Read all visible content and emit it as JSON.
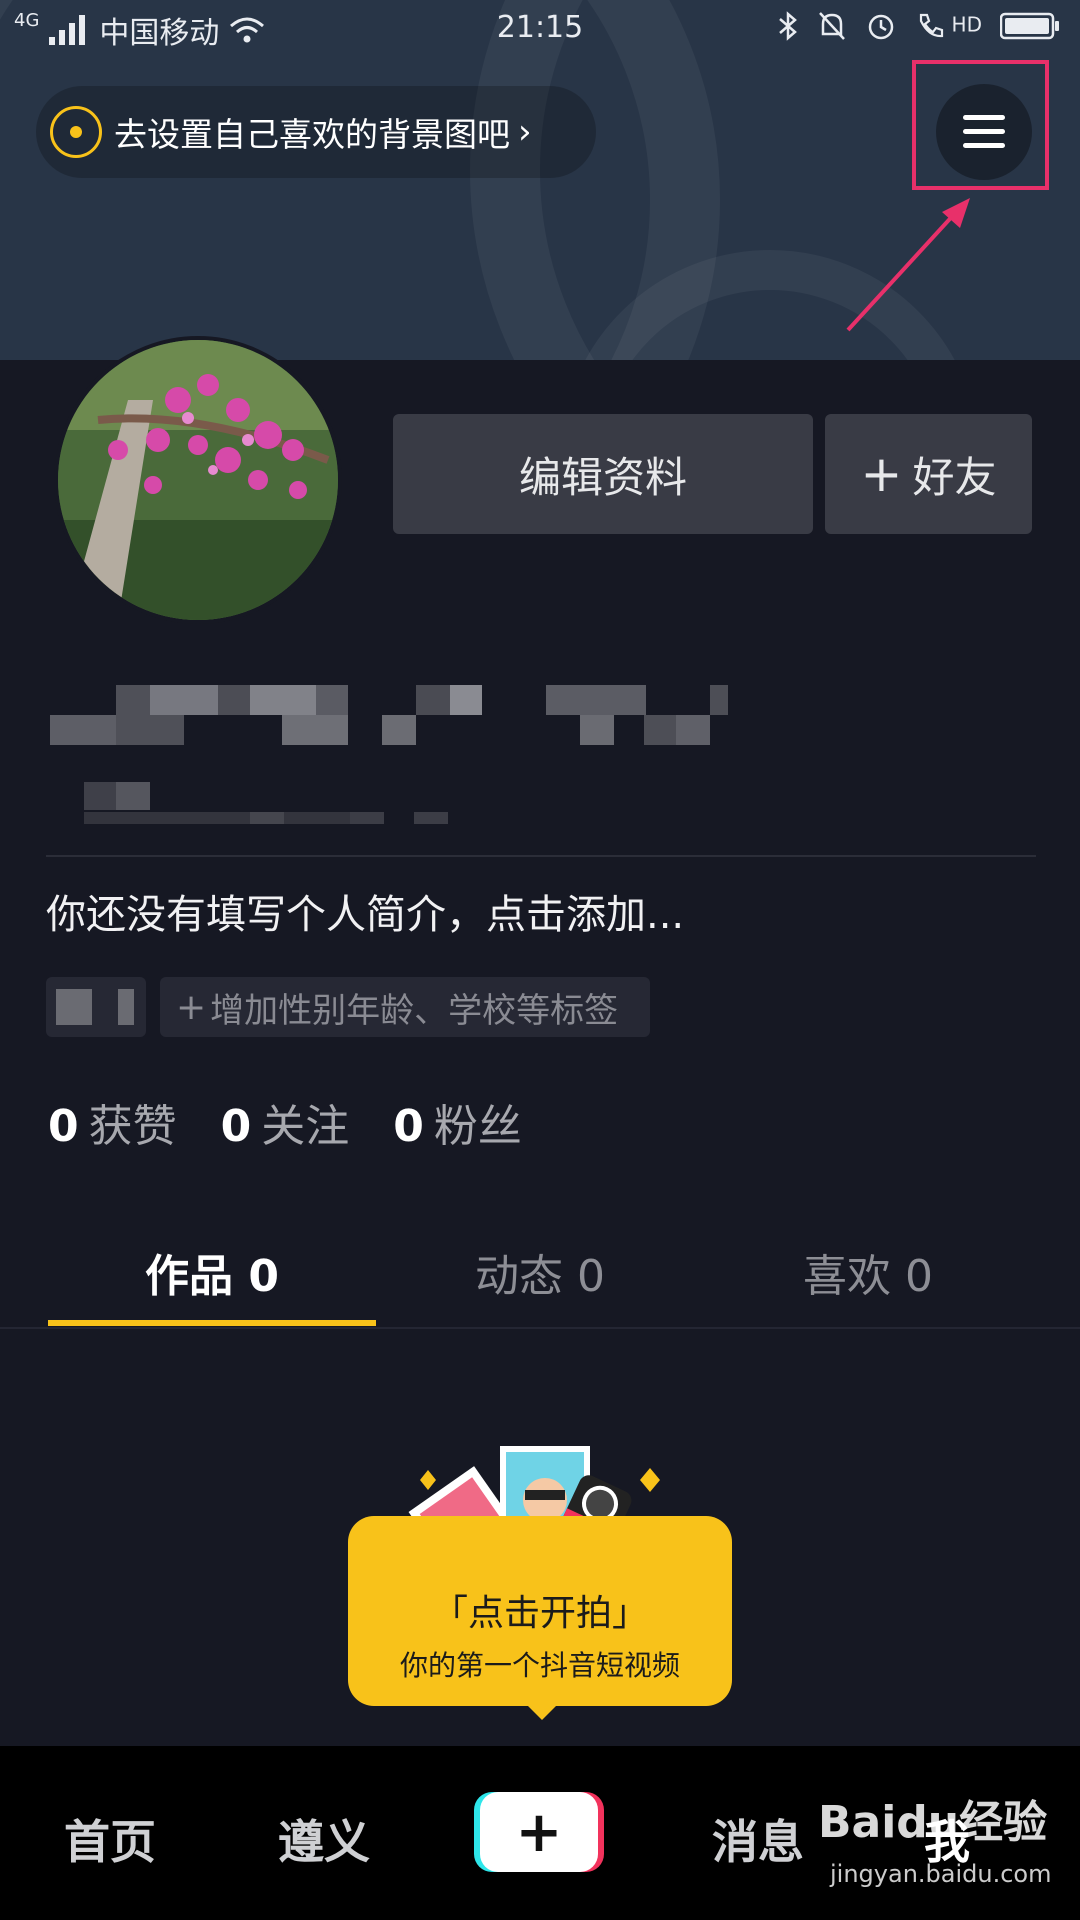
{
  "status_bar": {
    "network": "4G",
    "carrier": "中国移动",
    "time": "21:15",
    "hd": "HD"
  },
  "header": {
    "background_tip": "去设置自己喜欢的背景图吧",
    "chevron": "›"
  },
  "profile": {
    "edit_profile_label": "编辑资料",
    "add_friend_label": "好友",
    "add_friend_plus": "+"
  },
  "bio": {
    "placeholder": "你还没有填写个人简介，点击添加..."
  },
  "tags": {
    "add_tags": "增加性别年龄、学校等标签"
  },
  "stats": [
    {
      "value": "0",
      "label": "获赞"
    },
    {
      "value": "0",
      "label": "关注"
    },
    {
      "value": "0",
      "label": "粉丝"
    }
  ],
  "tabs": [
    {
      "label": "作品 0"
    },
    {
      "label": "动态 0"
    },
    {
      "label": "喜欢 0"
    }
  ],
  "shoot_card": {
    "title": "「点击开拍」",
    "subtitle": "你的第一个抖音短视频"
  },
  "bottom_nav": {
    "home": "首页",
    "city": "遵义",
    "plus": "+",
    "messages": "消息",
    "me": "我"
  },
  "watermark": {
    "brand": "Baidu经验",
    "url": "jingyan.baidu.com"
  },
  "colors": {
    "accent": "#f8c21a",
    "highlight_box": "#e8306a",
    "background": "#161823"
  }
}
